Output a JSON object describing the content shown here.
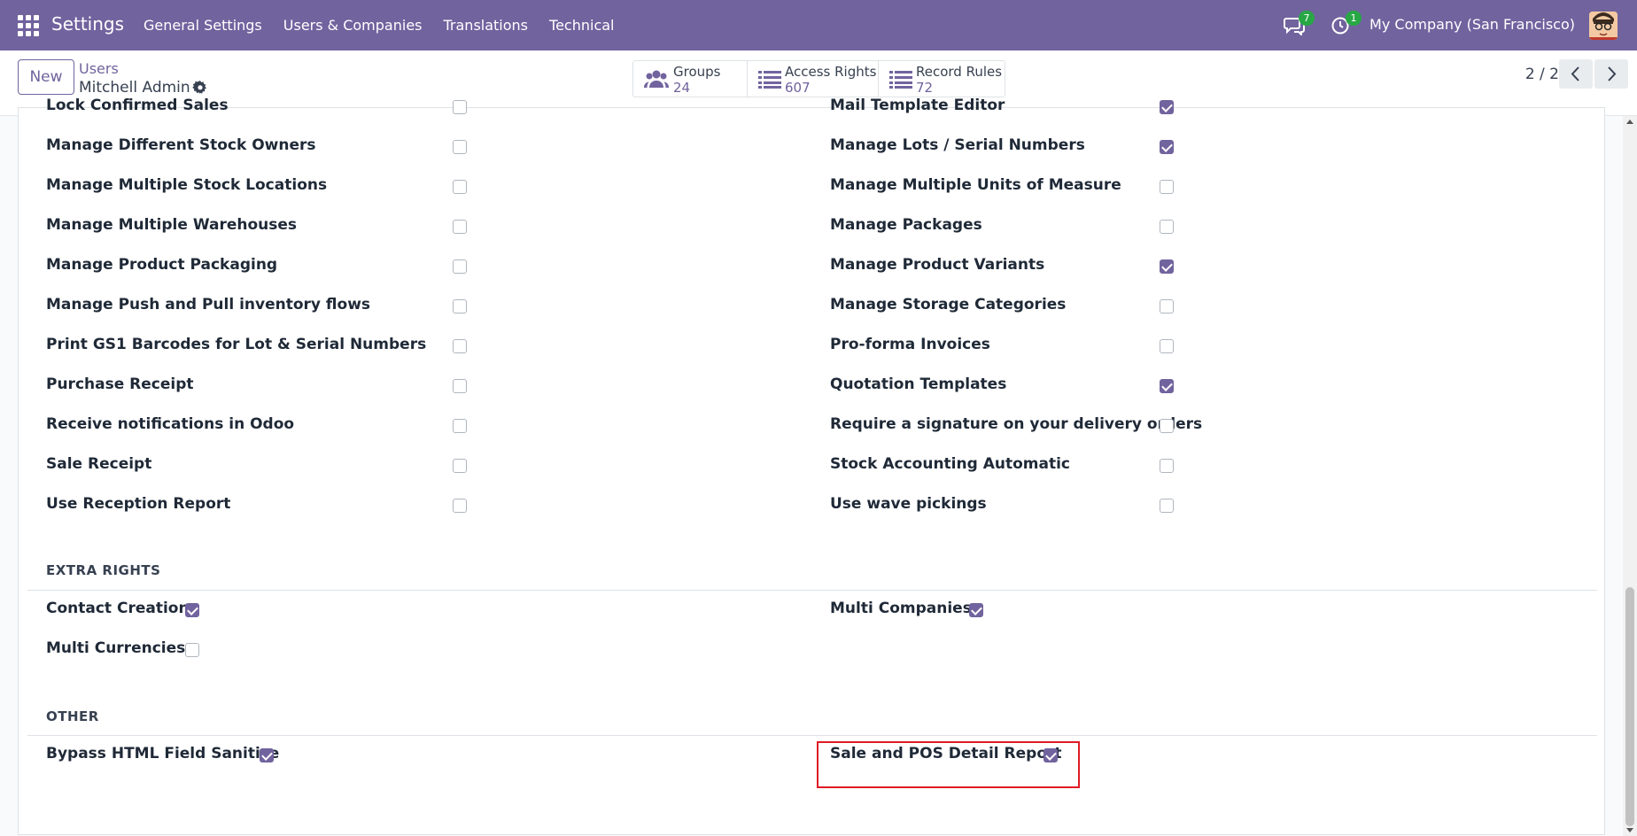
{
  "navbar": {
    "app_title": "Settings",
    "menu": [
      "General Settings",
      "Users & Companies",
      "Translations",
      "Technical"
    ],
    "messages_badge": "7",
    "activity_badge": "1",
    "company": "My Company (San Francisco)"
  },
  "control": {
    "new_label": "New",
    "breadcrumb": "Users",
    "record_name": "Mitchell Admin",
    "stats": [
      {
        "label": "Groups",
        "value": "24"
      },
      {
        "label": "Access Rights",
        "value": "607"
      },
      {
        "label": "Record Rules",
        "value": "72"
      }
    ],
    "pager": "2 / 2"
  },
  "technical_left": [
    {
      "label": "Lock Confirmed Sales",
      "checked": false
    },
    {
      "label": "Manage Different Stock Owners",
      "checked": false
    },
    {
      "label": "Manage Multiple Stock Locations",
      "checked": false
    },
    {
      "label": "Manage Multiple Warehouses",
      "checked": false
    },
    {
      "label": "Manage Product Packaging",
      "checked": false
    },
    {
      "label": "Manage Push and Pull inventory flows",
      "checked": false
    },
    {
      "label": "Print GS1 Barcodes for Lot & Serial Numbers",
      "checked": false
    },
    {
      "label": "Purchase Receipt",
      "checked": false
    },
    {
      "label": "Receive notifications in Odoo",
      "checked": false
    },
    {
      "label": "Sale Receipt",
      "checked": false
    },
    {
      "label": "Use Reception Report",
      "checked": false
    }
  ],
  "technical_right": [
    {
      "label": "Mail Template Editor",
      "checked": true
    },
    {
      "label": "Manage Lots / Serial Numbers",
      "checked": true
    },
    {
      "label": "Manage Multiple Units of Measure",
      "checked": false
    },
    {
      "label": "Manage Packages",
      "checked": false
    },
    {
      "label": "Manage Product Variants",
      "checked": true
    },
    {
      "label": "Manage Storage Categories",
      "checked": false
    },
    {
      "label": "Pro-forma Invoices",
      "checked": false
    },
    {
      "label": "Quotation Templates",
      "checked": true
    },
    {
      "label": "Require a signature on your delivery orders",
      "checked": false
    },
    {
      "label": "Stock Accounting Automatic",
      "checked": false
    },
    {
      "label": "Use wave pickings",
      "checked": false
    }
  ],
  "extra_rights": {
    "title": "EXTRA RIGHTS",
    "items": [
      {
        "label": "Contact Creation",
        "checked": true
      },
      {
        "label": "Multi Companies",
        "checked": true
      },
      {
        "label": "Multi Currencies",
        "checked": false
      }
    ]
  },
  "other": {
    "title": "OTHER",
    "items": [
      {
        "label": "Bypass HTML Field Sanitize",
        "checked": true
      },
      {
        "label": "Sale and POS Detail Report",
        "checked": true
      }
    ]
  },
  "colors": {
    "brand": "#71639e",
    "highlight": "#e01b24",
    "badge": "#28a745"
  }
}
